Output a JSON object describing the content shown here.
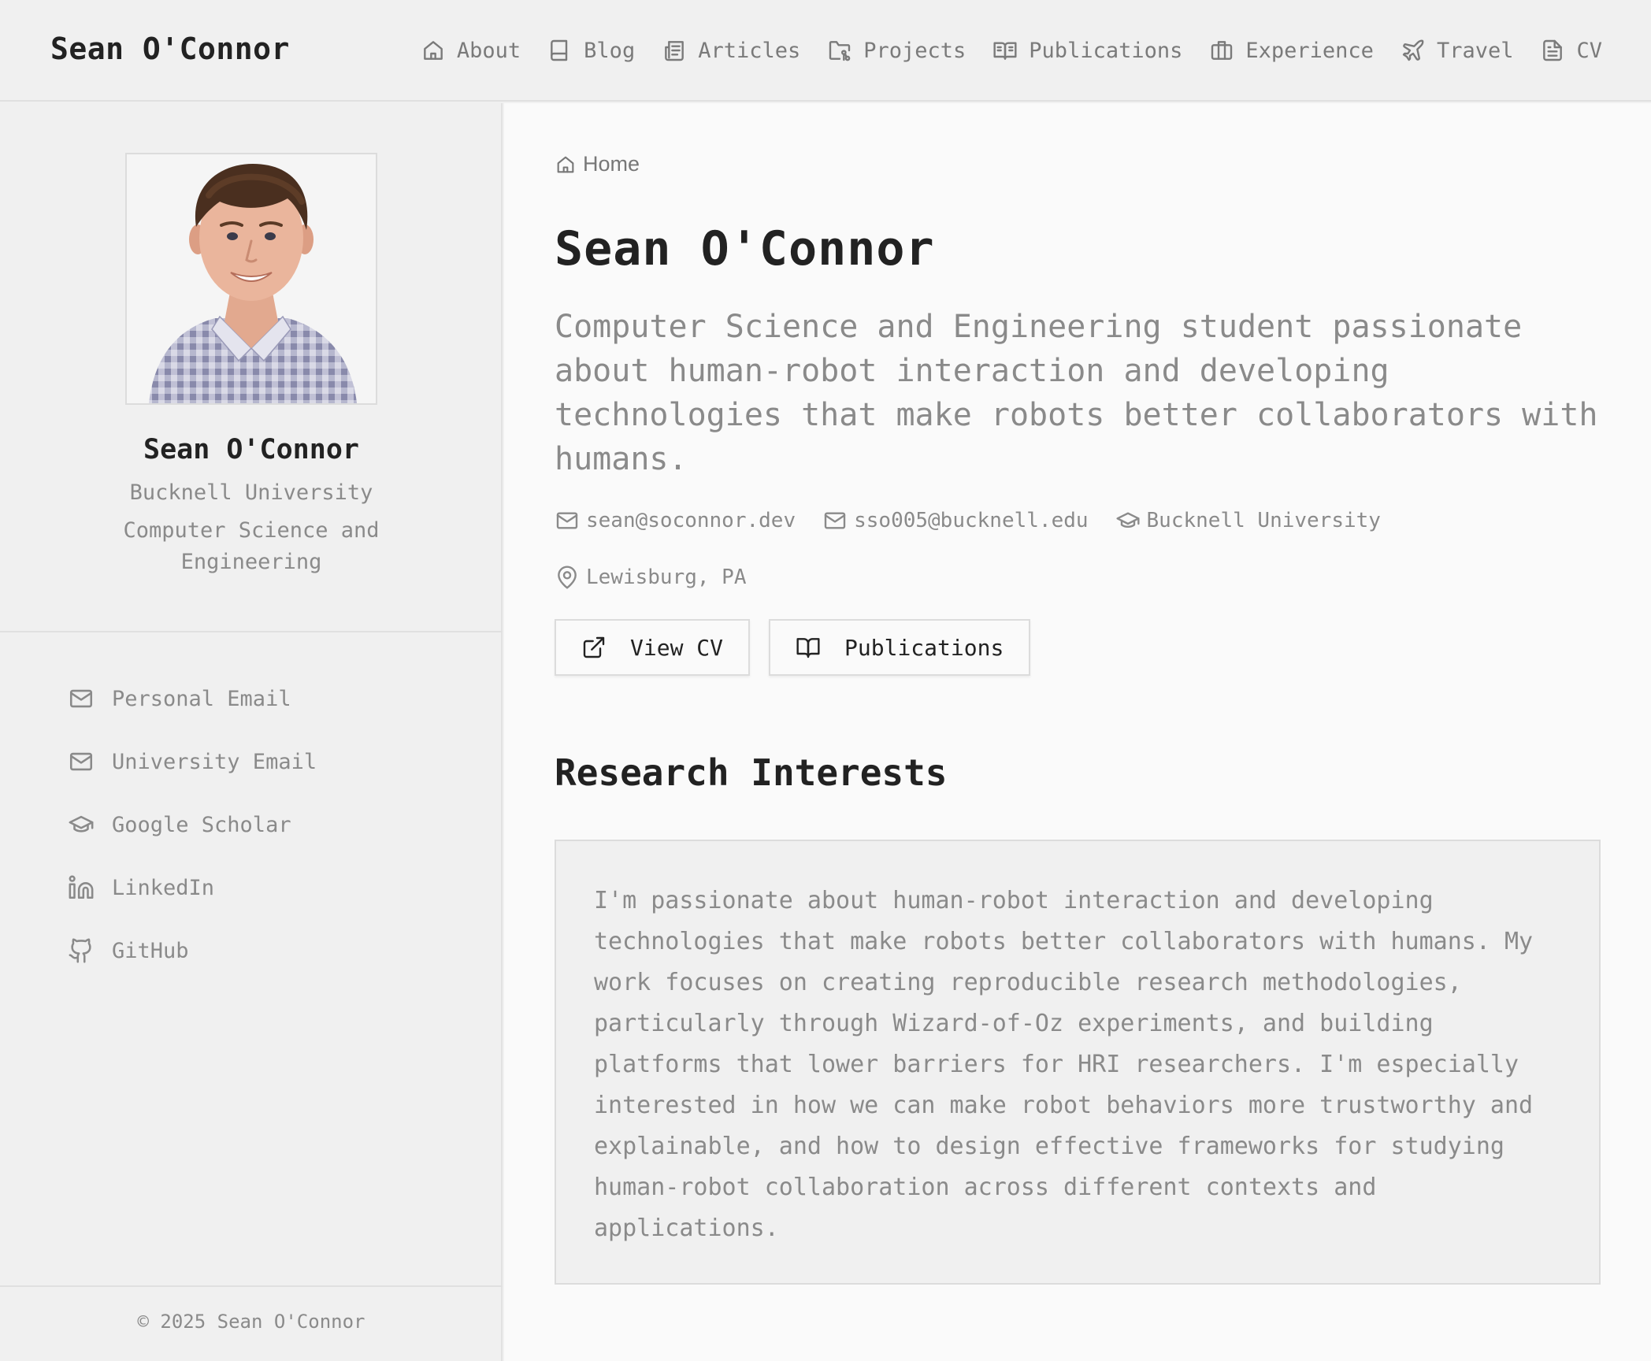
{
  "header": {
    "site_title": "Sean O'Connor",
    "nav": [
      {
        "label": "About",
        "icon": "home-icon"
      },
      {
        "label": "Blog",
        "icon": "book-icon"
      },
      {
        "label": "Articles",
        "icon": "newspaper-icon"
      },
      {
        "label": "Projects",
        "icon": "folder-git-icon"
      },
      {
        "label": "Publications",
        "icon": "book-open-icon"
      },
      {
        "label": "Experience",
        "icon": "briefcase-icon"
      },
      {
        "label": "Travel",
        "icon": "plane-icon"
      },
      {
        "label": "CV",
        "icon": "file-text-icon"
      }
    ]
  },
  "sidebar": {
    "name": "Sean O'Connor",
    "university": "Bucknell University",
    "program": "Computer Science and Engineering",
    "links": [
      {
        "label": "Personal Email",
        "icon": "mail-icon"
      },
      {
        "label": "University Email",
        "icon": "mail-icon"
      },
      {
        "label": "Google Scholar",
        "icon": "graduation-cap-icon"
      },
      {
        "label": "LinkedIn",
        "icon": "linkedin-icon"
      },
      {
        "label": "GitHub",
        "icon": "github-icon"
      }
    ],
    "footer": "© 2025 Sean O'Connor"
  },
  "main": {
    "breadcrumb": "Home",
    "title": "Sean O'Connor",
    "lead": "Computer Science and Engineering student passionate about human-robot interaction and developing technologies that make robots better collaborators with humans.",
    "meta": {
      "personal_email": "sean@soconnor.dev",
      "university_email": "sso005@bucknell.edu",
      "university": "Bucknell University",
      "location": "Lewisburg, PA"
    },
    "buttons": {
      "view_cv": "View CV",
      "publications": "Publications"
    },
    "research_title": "Research Interests",
    "research_text": "I'm passionate about human-robot interaction and developing technologies that make robots better collaborators with humans. My work focuses on creating reproducible research methodologies, particularly through Wizard-of-Oz experiments, and building platforms that lower barriers for HRI researchers. I'm especially interested in how we can make robot behaviors more trustworthy and explainable, and how to design effective frameworks for studying human-robot collaboration across different contexts and applications."
  },
  "colors": {
    "background": "#f0f0f0",
    "main_background": "#fafafa",
    "text": "#222222",
    "muted_text": "#8a8a8a",
    "border": "#dcdcdc"
  }
}
